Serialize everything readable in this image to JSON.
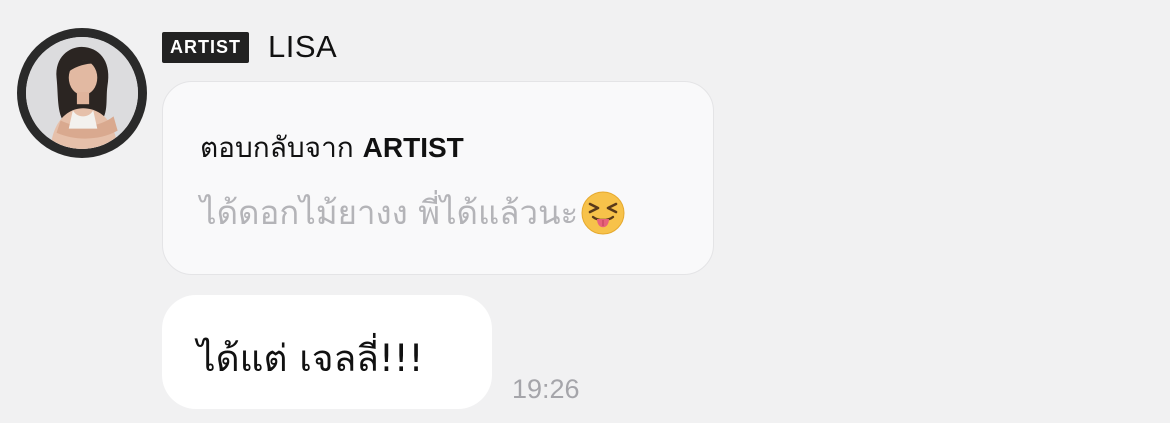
{
  "sender": {
    "badge": "ARTIST",
    "name": "LISA",
    "avatar": "avatar-photo"
  },
  "reply": {
    "label_prefix": "ตอบกลับจาก",
    "label_artist": "ARTIST",
    "quoted_text": "ได้ดอกไม้ยางง พี่ได้แล้วนะ",
    "emoji": "squinting-face-with-tongue-icon"
  },
  "message": {
    "text": "ได้แต่ เจลลี่!!!",
    "time": "19:26"
  },
  "colors": {
    "background": "#f1f1f2",
    "badge_bg": "#222222",
    "bubble_bg": "#ffffff",
    "reply_bubble_bg": "#f9f9fa",
    "quoted_text": "#b4b4b8",
    "timestamp": "#a5a5aa"
  }
}
